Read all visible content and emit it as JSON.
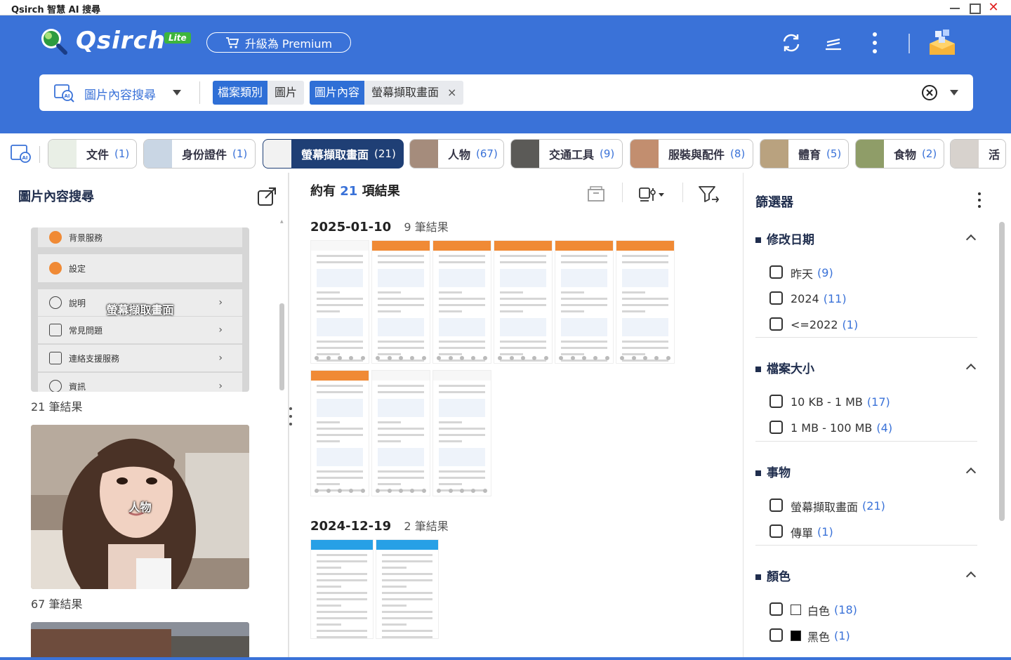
{
  "window": {
    "title": "Qsirch 智慧 AI 搜尋"
  },
  "header": {
    "logo_text": "Qsirch",
    "badge": "Lite",
    "premium_label": "升級為 Premium",
    "icons": [
      "refresh-icon",
      "tasks-icon",
      "more-icon",
      "app-center-icon"
    ]
  },
  "search": {
    "mode_label": "圖片內容搜尋",
    "chips": [
      {
        "key": "檔案類別",
        "value": "圖片"
      },
      {
        "key": "圖片內容",
        "value": "螢幕擷取畫面",
        "removable": "×"
      }
    ]
  },
  "categories": [
    {
      "label": "文件",
      "count": "(1)",
      "thumb": "#e9efe6"
    },
    {
      "label": "身份證件",
      "count": "(1)",
      "thumb": "#c9d6e4"
    },
    {
      "label": "螢幕擷取畫面",
      "count": "(21)",
      "thumb": "#f2f2f2",
      "active": true
    },
    {
      "label": "人物",
      "count": "(67)",
      "thumb": "#a58c7c"
    },
    {
      "label": "交通工具",
      "count": "(9)",
      "thumb": "#5b5a57"
    },
    {
      "label": "服裝與配件",
      "count": "(8)",
      "thumb": "#c28e6f"
    },
    {
      "label": "體育",
      "count": "(5)",
      "thumb": "#b9a27f"
    },
    {
      "label": "食物",
      "count": "(2)",
      "thumb": "#8f9d68"
    },
    {
      "label": "活",
      "count": "",
      "thumb": "#d7d2cd"
    }
  ],
  "left_panel": {
    "title": "圖片內容搜尋",
    "cards": [
      {
        "overlay": "螢幕擷取畫面",
        "count": "21 筆結果",
        "mini_rows": [
          "背景服務",
          "設定",
          "說明",
          "常見問題",
          "連絡支援服務",
          "資訊"
        ]
      },
      {
        "overlay": "人物",
        "count": "67 筆結果"
      }
    ]
  },
  "results": {
    "summary_prefix": "約有",
    "summary_count": "21",
    "summary_suffix": "項結果",
    "groups": [
      {
        "date": "2025-01-10",
        "count": "9 筆結果"
      },
      {
        "date": "2024-12-19",
        "count": "2 筆結果"
      }
    ],
    "toolbar_icons": [
      "archive-icon",
      "view-options-icon",
      "filter-toggle-icon"
    ]
  },
  "filters": {
    "title": "篩選器",
    "groups": [
      {
        "title": "修改日期",
        "options": [
          {
            "label": "昨天",
            "count": "(9)"
          },
          {
            "label": "2024",
            "count": "(11)"
          },
          {
            "label": "<=2022",
            "count": "(1)"
          }
        ]
      },
      {
        "title": "檔案大小",
        "options": [
          {
            "label": "10 KB - 1 MB",
            "count": "(17)"
          },
          {
            "label": "1 MB - 100 MB",
            "count": "(4)"
          }
        ]
      },
      {
        "title": "事物",
        "options": [
          {
            "label": "螢幕擷取畫面",
            "count": "(21)"
          },
          {
            "label": "傳單",
            "count": "(1)"
          }
        ]
      },
      {
        "title": "顏色",
        "options": [
          {
            "label": "白色",
            "count": "(18)",
            "swatch": "#ffffff"
          },
          {
            "label": "黑色",
            "count": "(1)",
            "swatch": "#000000"
          }
        ]
      }
    ]
  },
  "colors": {
    "brand_blue": "#3a72d8",
    "accent_orange": "#f08a35",
    "active_chip": "#1f3f75"
  }
}
